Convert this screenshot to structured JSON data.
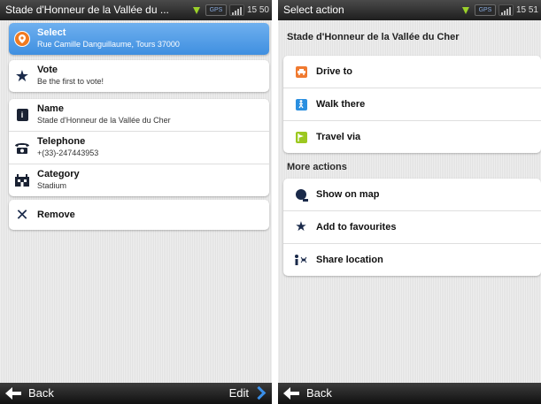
{
  "left": {
    "status": {
      "title": "Stade d'Honneur de la Vallée du ...",
      "gps": "GPS",
      "time": "15  50"
    },
    "select": {
      "title": "Select",
      "address": "Rue Camille Danguillaume,  Tours 37000"
    },
    "vote": {
      "title": "Vote",
      "subtitle": "Be the first to vote!"
    },
    "details": [
      {
        "label": "Name",
        "value": "Stade d'Honneur de la Vallée du Cher",
        "icon": "info-icon"
      },
      {
        "label": "Telephone",
        "value": "+(33)-247443953",
        "icon": "telephone-icon"
      },
      {
        "label": "Category",
        "value": "Stadium",
        "icon": "stadium-icon"
      }
    ],
    "remove": {
      "label": "Remove"
    },
    "bottom": {
      "back": "Back",
      "edit": "Edit"
    }
  },
  "right": {
    "status": {
      "title": "Select action",
      "gps": "GPS",
      "time": "15  51"
    },
    "place_title": "Stade d'Honneur de la Vallée du Cher",
    "actions": [
      {
        "label": "Drive to",
        "icon": "car-icon",
        "color": "#f07a30"
      },
      {
        "label": "Walk there",
        "icon": "walk-icon",
        "color": "#2a8fe0"
      },
      {
        "label": "Travel via",
        "icon": "flag-icon",
        "color": "#9cc820"
      }
    ],
    "more_actions_label": "More actions",
    "more_actions": [
      {
        "label": "Show on map",
        "icon": "map-icon"
      },
      {
        "label": "Add to favourites",
        "icon": "star-icon"
      },
      {
        "label": "Share location",
        "icon": "share-icon"
      }
    ],
    "bottom": {
      "back": "Back"
    }
  },
  "colors": {
    "accent_blue": "#4a96e6",
    "status_bar": "#2b2b2b"
  }
}
